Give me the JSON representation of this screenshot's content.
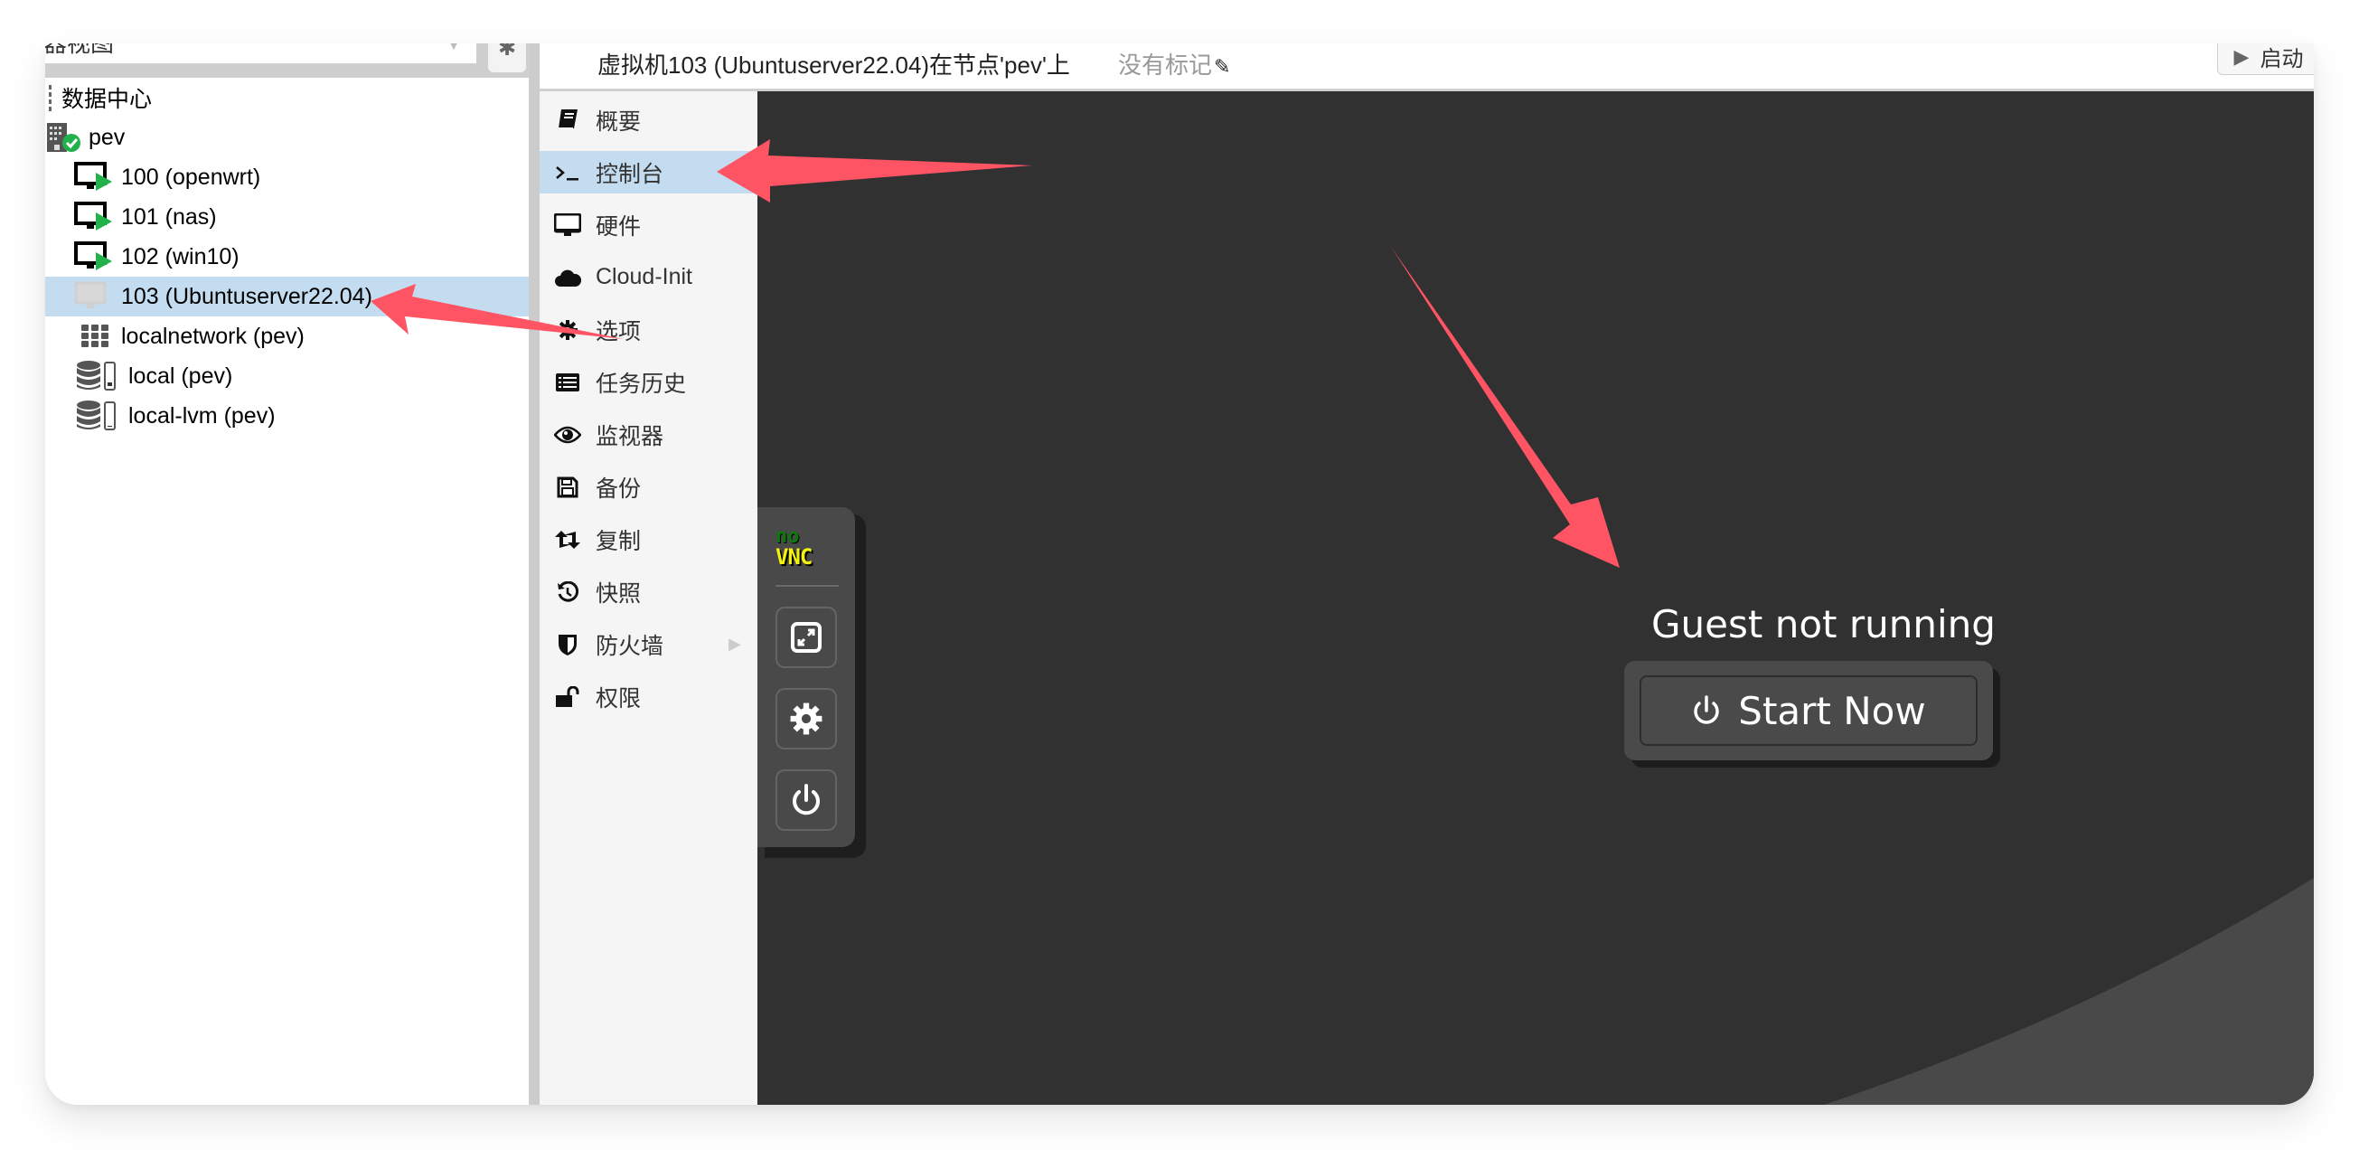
{
  "tree_panel": {
    "view_selector_value": "器视图",
    "items": [
      {
        "label": "数据中心",
        "icon": "datacenter-icon",
        "level": 0
      },
      {
        "label": "pev",
        "icon": "node-online-icon",
        "level": 1
      },
      {
        "label": "100 (openwrt)",
        "icon": "vm-running-icon",
        "level": 2
      },
      {
        "label": "101 (nas)",
        "icon": "vm-running-icon",
        "level": 2
      },
      {
        "label": "102 (win10)",
        "icon": "vm-running-icon",
        "level": 2
      },
      {
        "label": "103 (Ubuntuserver22.04)",
        "icon": "vm-stopped-icon",
        "level": 2,
        "selected": true
      },
      {
        "label": "localnetwork (pev)",
        "icon": "network-grid-icon",
        "level": 2
      },
      {
        "label": "local (pev)",
        "icon": "storage-icon",
        "level": 2
      },
      {
        "label": "local-lvm (pev)",
        "icon": "storage-icon",
        "level": 2
      }
    ]
  },
  "header": {
    "title": "虚拟机103 (Ubuntuserver22.04)在节点'pev'上",
    "tags": "没有标记",
    "start_label": "启动"
  },
  "menu": {
    "items": [
      {
        "label": "概要",
        "icon": "book-icon"
      },
      {
        "label": "控制台",
        "icon": "terminal-icon",
        "active": true
      },
      {
        "label": "硬件",
        "icon": "monitor-icon"
      },
      {
        "label": "Cloud-Init",
        "icon": "cloud-icon"
      },
      {
        "label": "选项",
        "icon": "gear-icon"
      },
      {
        "label": "任务历史",
        "icon": "list-icon"
      },
      {
        "label": "监视器",
        "icon": "eye-icon"
      },
      {
        "label": "备份",
        "icon": "floppy-icon"
      },
      {
        "label": "复制",
        "icon": "retweet-icon"
      },
      {
        "label": "快照",
        "icon": "history-icon"
      },
      {
        "label": "防火墙",
        "icon": "shield-icon",
        "has_submenu": true
      },
      {
        "label": "权限",
        "icon": "unlock-icon"
      }
    ]
  },
  "console": {
    "novnc_logo_top": "no",
    "novnc_logo_bottom": "VNC",
    "status_text": "Guest not running",
    "start_now_label": "Start Now"
  },
  "colors": {
    "selection": "#c3dcf0",
    "console_bg": "#313131",
    "annotation_arrow": "#ff5464",
    "running_green": "#21b24b"
  },
  "annotations": [
    {
      "type": "arrow",
      "points_to": "menu-item-控制台"
    },
    {
      "type": "arrow",
      "points_to": "tree-item-103"
    },
    {
      "type": "arrow",
      "points_to": "start-now-button"
    }
  ]
}
